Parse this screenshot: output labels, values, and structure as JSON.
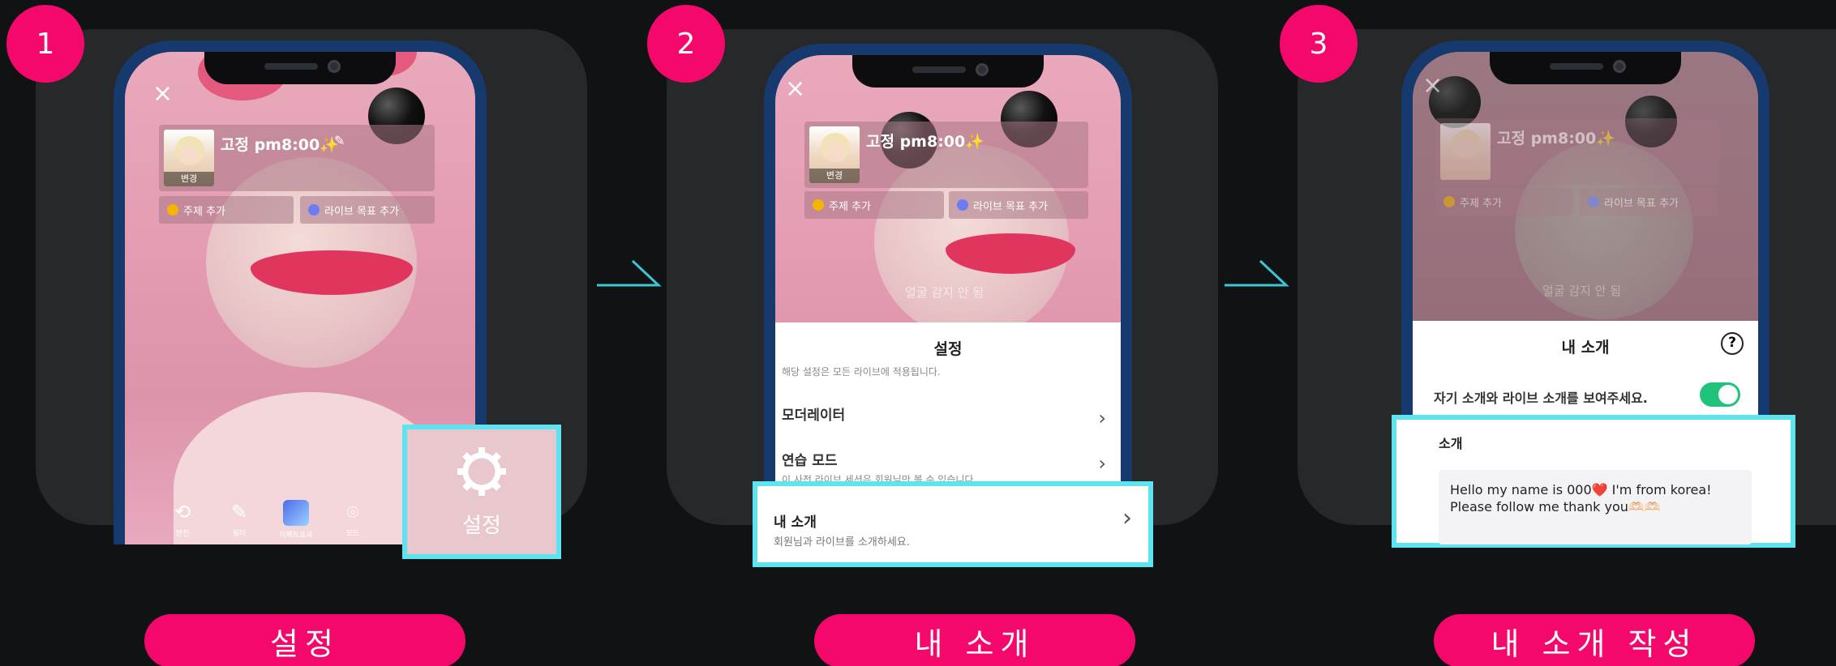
{
  "steps": [
    {
      "number": "1",
      "caption": "설정"
    },
    {
      "number": "2",
      "caption": "내 소개"
    },
    {
      "number": "3",
      "caption": "내 소개 작성"
    }
  ],
  "live_screen": {
    "close_icon": "×",
    "title": "고정 pm8:00✨",
    "thumb_label": "변경",
    "topic_chip": "주제 추가",
    "goal_chip": "라이브 목표 추가",
    "toolbar": [
      "반전",
      "필터",
      "이팩트효과",
      "모드"
    ],
    "settings_label": "설정"
  },
  "face_hint": "얼굴 감지 안 됨",
  "settings_sheet": {
    "title": "설정",
    "cut_text": "해당 설정은 모든 라이브에 적용됩니다.",
    "rows": [
      {
        "label": "모더레이터",
        "sub": ""
      },
      {
        "label": "연습 모드",
        "sub": "이 사전 라이브 세션은 회원님만 볼 수 있습니다."
      },
      {
        "label": "내 소개",
        "sub": "회원님과 라이브를 소개하세요."
      }
    ]
  },
  "intro_sheet": {
    "title": "내 소개",
    "help_icon": "?",
    "toggle_label": "자기 소개와 라이브 소개를 보여주세요.",
    "toggle_on": true,
    "section_label": "소개",
    "intro_text_1": "Hello my name is 000❤️ I'm from korea!",
    "intro_text_2": "Please follow me thank you🫶🏻🫶🏻"
  },
  "colors": {
    "accent_pink": "#f5086b",
    "highlight_cyan": "#5ee3f0",
    "toggle_green": "#21c27a",
    "panel_bg": "#26282a"
  }
}
